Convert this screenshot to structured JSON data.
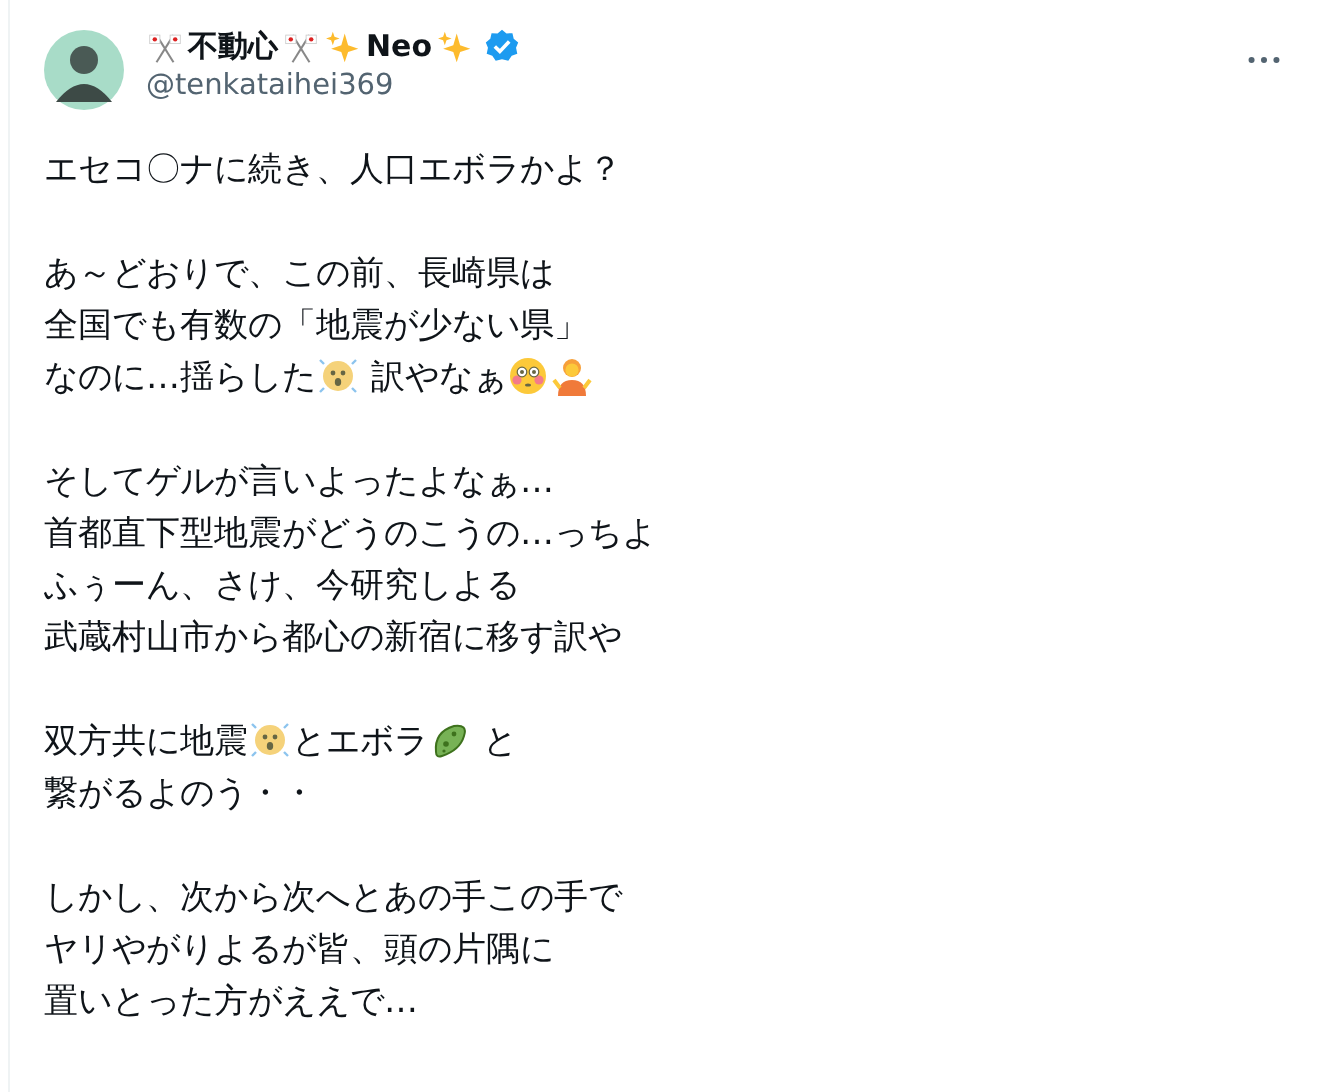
{
  "author": {
    "display_name": [
      {
        "kind": "crossed-flags"
      },
      {
        "kind": "text",
        "text": "不動心"
      },
      {
        "kind": "crossed-flags"
      },
      {
        "kind": "sparkles"
      },
      {
        "kind": "text",
        "text": "Neo"
      },
      {
        "kind": "sparkles"
      }
    ],
    "verified": true,
    "handle": "@tenkataihei369"
  },
  "paragraphs": [
    [
      [
        {
          "kind": "text",
          "text": "エセコ〇ナに続き、人口エボラかよ？"
        }
      ]
    ],
    [
      [
        {
          "kind": "text",
          "text": "あ～どおりで、この前、長崎県は"
        }
      ],
      [
        {
          "kind": "text",
          "text": "全国でも有数の「地震が少ない県」"
        }
      ],
      [
        {
          "kind": "text",
          "text": "なのに…揺らした"
        },
        {
          "kind": "shaking-face"
        },
        {
          "kind": "text",
          "text": " 訳やなぁ"
        },
        {
          "kind": "flushed-face"
        },
        {
          "kind": "shrugging-person"
        }
      ]
    ],
    [
      [
        {
          "kind": "text",
          "text": "そしてゲルが言いよったよなぁ…"
        }
      ],
      [
        {
          "kind": "text",
          "text": "首都直下型地震がどうのこうの…っちよ"
        }
      ],
      [
        {
          "kind": "text",
          "text": "ふぅーん、さけ、今研究しよる"
        }
      ],
      [
        {
          "kind": "text",
          "text": "武蔵村山市から都心の新宿に移す訳や"
        }
      ]
    ],
    [
      [
        {
          "kind": "text",
          "text": "双方共に地震"
        },
        {
          "kind": "shaking-face"
        },
        {
          "kind": "text",
          "text": "とエボラ"
        },
        {
          "kind": "microbe"
        },
        {
          "kind": "text",
          "text": " と"
        }
      ],
      [
        {
          "kind": "text",
          "text": "繋がるよのう・・"
        }
      ]
    ],
    [
      [
        {
          "kind": "text",
          "text": "しかし、次から次へとあの手この手で"
        }
      ],
      [
        {
          "kind": "text",
          "text": "ヤリやがりよるが皆、頭の片隅に"
        }
      ],
      [
        {
          "kind": "text",
          "text": "置いとった方がええで…"
        }
      ]
    ]
  ]
}
